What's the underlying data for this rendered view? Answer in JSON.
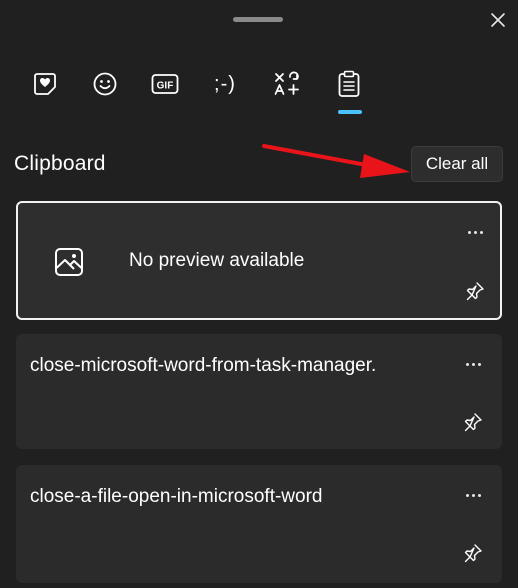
{
  "tabs": [
    {
      "name": "favorites-emoji",
      "icon": "heart-sticker-icon"
    },
    {
      "name": "emoji",
      "icon": "smiley-icon"
    },
    {
      "name": "gif",
      "icon": "gif-icon",
      "label": "GIF"
    },
    {
      "name": "kaomoji",
      "icon": "kaomoji-icon",
      "label": ";-)"
    },
    {
      "name": "symbols",
      "icon": "symbols-icon"
    },
    {
      "name": "clipboard",
      "icon": "clipboard-icon",
      "active": true
    }
  ],
  "clipboard": {
    "title": "Clipboard",
    "clear_all_label": "Clear all",
    "items": [
      {
        "type": "image",
        "text": "No preview available",
        "icon": "image-icon",
        "selected": true
      },
      {
        "type": "text",
        "text": "close-microsoft-word-from-task-manager."
      },
      {
        "type": "text",
        "text": "close-a-file-open-in-microsoft-word"
      }
    ]
  },
  "colors": {
    "background": "#202020",
    "card": "#2b2b2b",
    "accent": "#4cc2ff",
    "annotation_arrow": "#e8141a"
  }
}
